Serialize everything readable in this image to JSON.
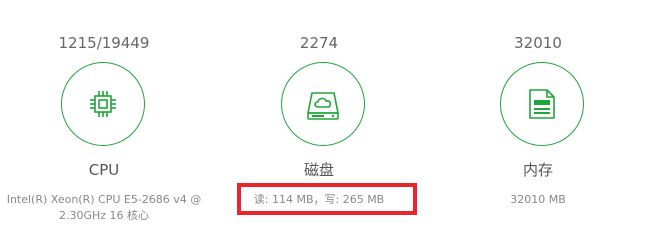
{
  "cpu": {
    "value": "1215/19449",
    "label": "CPU",
    "desc_line1": "Intel(R) Xeon(R) CPU E5-2686 v4 @",
    "desc_line2": "2.30GHz 16 核心",
    "icon": "cpu-chip-icon"
  },
  "disk": {
    "value": "2274",
    "label": "磁盘",
    "desc": "读: 114 MB，写: 265 MB",
    "icon": "cloud-disk-icon"
  },
  "memory": {
    "value": "32010",
    "label": "内存",
    "desc": "32010 MB",
    "icon": "memory-document-icon"
  },
  "colors": {
    "accent": "#20a53a",
    "highlight": "#e8262b"
  }
}
